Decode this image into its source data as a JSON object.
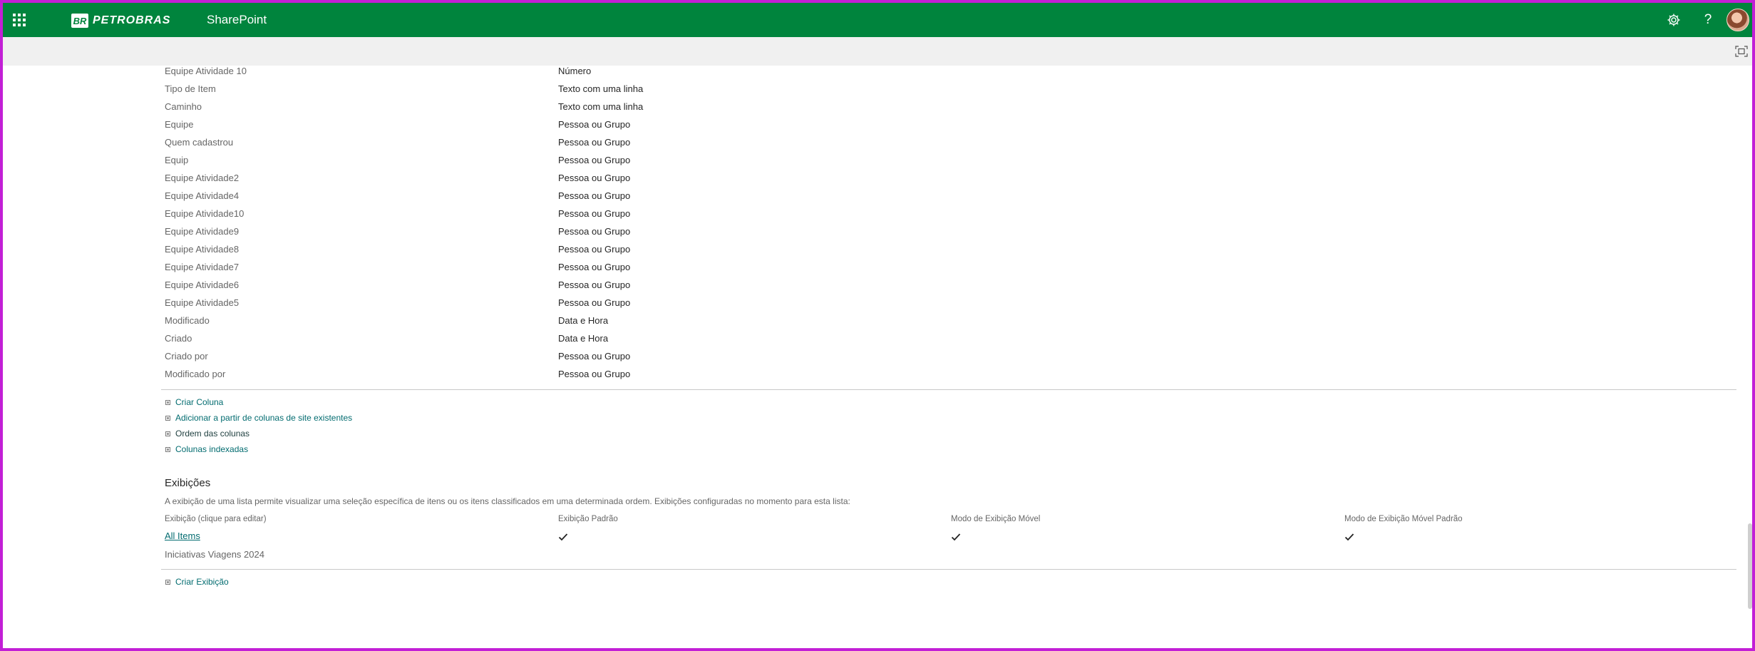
{
  "header": {
    "brand_mark": "BR",
    "brand_name": "PETROBRAS",
    "app_name": "SharePoint"
  },
  "colors": {
    "suitebar": "#00843d",
    "link": "#036c70",
    "frame": "#c21fd6"
  },
  "columns": [
    {
      "name": "Equipe Atividade 10",
      "type": "Número"
    },
    {
      "name": "Tipo de Item",
      "type": "Texto com uma linha"
    },
    {
      "name": "Caminho",
      "type": "Texto com uma linha"
    },
    {
      "name": "Equipe",
      "type": "Pessoa ou Grupo"
    },
    {
      "name": "Quem cadastrou",
      "type": "Pessoa ou Grupo"
    },
    {
      "name": "Equip",
      "type": "Pessoa ou Grupo"
    },
    {
      "name": "Equipe Atividade2",
      "type": "Pessoa ou Grupo"
    },
    {
      "name": "Equipe Atividade4",
      "type": "Pessoa ou Grupo"
    },
    {
      "name": "Equipe Atividade10",
      "type": "Pessoa ou Grupo"
    },
    {
      "name": "Equipe Atividade9",
      "type": "Pessoa ou Grupo"
    },
    {
      "name": "Equipe Atividade8",
      "type": "Pessoa ou Grupo"
    },
    {
      "name": "Equipe Atividade7",
      "type": "Pessoa ou Grupo"
    },
    {
      "name": "Equipe Atividade6",
      "type": "Pessoa ou Grupo"
    },
    {
      "name": "Equipe Atividade5",
      "type": "Pessoa ou Grupo"
    },
    {
      "name": "Modificado",
      "type": "Data e Hora"
    },
    {
      "name": "Criado",
      "type": "Data e Hora"
    },
    {
      "name": "Criado por",
      "type": "Pessoa ou Grupo"
    },
    {
      "name": "Modificado por",
      "type": "Pessoa ou Grupo"
    }
  ],
  "column_links": {
    "create": "Criar Coluna",
    "add_existing": "Adicionar a partir de colunas de site existentes",
    "order": "Ordem das colunas",
    "indexed": "Colunas indexadas"
  },
  "views": {
    "title": "Exibições",
    "description": "A exibição de uma lista permite visualizar uma seleção específica de itens ou os itens classificados em uma determinada ordem. Exibições configuradas no momento para esta lista:",
    "headers": {
      "view": "Exibição (clique para editar)",
      "default": "Exibição Padrão",
      "mobile": "Modo de Exibição Móvel",
      "mobile_default": "Modo de Exibição Móvel Padrão"
    },
    "rows": [
      {
        "name": "All Items",
        "default": true,
        "mobile": true,
        "mobile_default": true
      },
      {
        "name": "Iniciativas Viagens 2024",
        "default": false,
        "mobile": false,
        "mobile_default": false
      }
    ],
    "create_link": "Criar Exibição"
  }
}
